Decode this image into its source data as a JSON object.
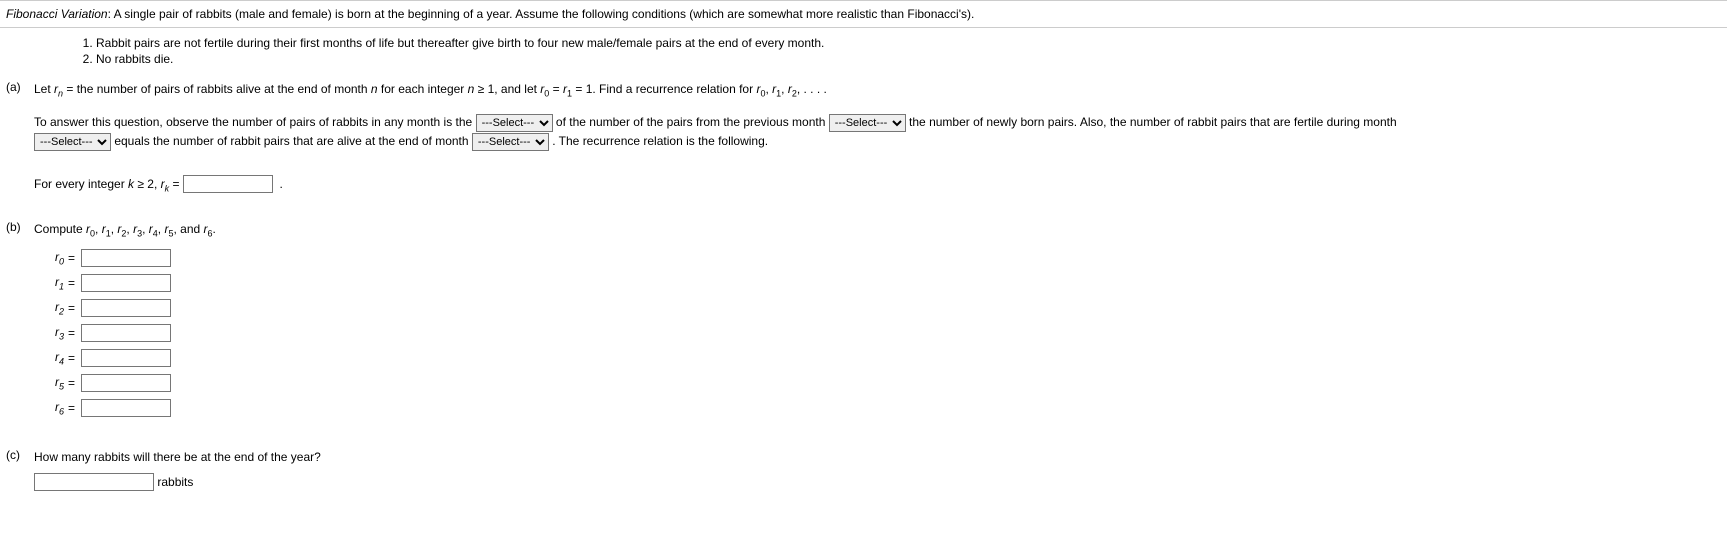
{
  "title_label": "Fibonacci Variation",
  "title_rest": ": A single pair of rabbits (male and female) is born at the beginning of a year. Assume the following conditions (which are somewhat more realistic than Fibonacci's).",
  "conditions": [
    "Rabbit pairs are not fertile during their first months of life but thereafter give birth to four new male/female pairs at the end of every month.",
    "No rabbits die."
  ],
  "parts": {
    "a": {
      "label": "(a)",
      "t1": "Let ",
      "t2": " = the number of pairs of rabbits alive at the end of month ",
      "t3": " for each integer ",
      "t4": " ≥ 1, and let ",
      "t5": " = ",
      "t6": " = 1. Find a recurrence relation for ",
      "t7": ", ",
      "t8": ", ",
      "t9": ", . . . .",
      "p2_a": "To answer this question, observe the number of pairs of rabbits in any month is the ",
      "p2_b": " of the number of the pairs from the previous month ",
      "p2_c": " the number of newly born pairs. Also, the number of rabbit pairs that are fertile during month ",
      "p3_a": " equals the number of rabbit pairs that are alive at the end of month ",
      "p3_b": " . The recurrence relation is the following.",
      "foreach": "For every integer ",
      "foreach2": " ≥ 2, ",
      "foreach3": " = ",
      "period": "."
    },
    "b": {
      "label": "(b)",
      "t1": "Compute ",
      "and": "and",
      "labels": [
        "r",
        "r",
        "r",
        "r",
        "r",
        "r",
        "r"
      ],
      "subs": [
        "0",
        "1",
        "2",
        "3",
        "4",
        "5",
        "6"
      ]
    },
    "c": {
      "label": "(c)",
      "t1": "How many rabbits will there be at the end of the year?",
      "unit": "rabbits"
    }
  },
  "select_placeholder": "---Select---",
  "math": {
    "r": "r",
    "n": "n",
    "k": "k",
    "r0": "0",
    "r1": "1",
    "r2": "2"
  }
}
